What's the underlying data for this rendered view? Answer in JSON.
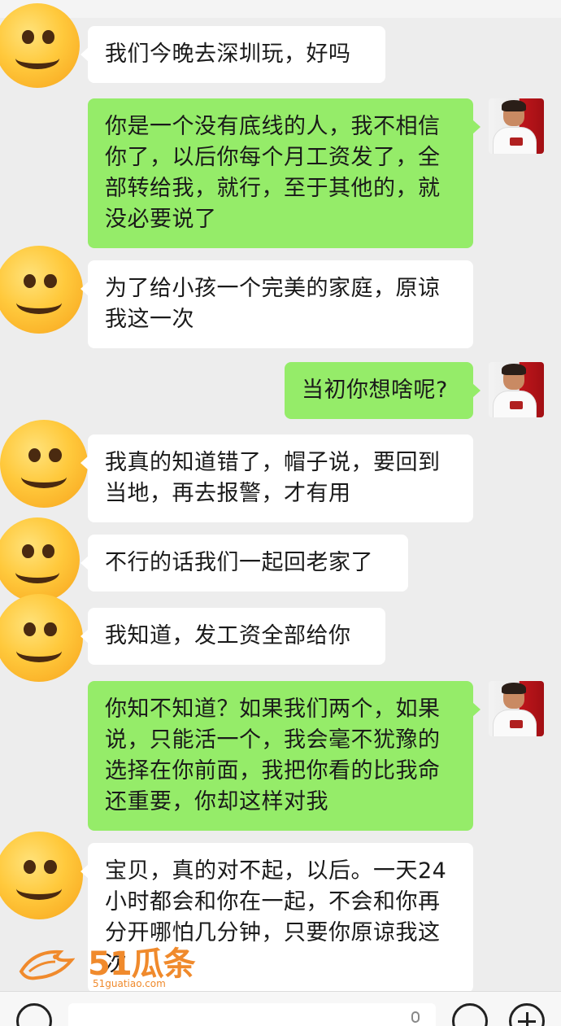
{
  "messages": [
    {
      "side": "left",
      "text": "我们今晚去深圳玩，好吗",
      "avatar": "smiley-emoji-avatar"
    },
    {
      "side": "right",
      "text": "你是一个没有底线的人，我不相信你了，以后你每个月工资发了，全部转给我，就行，至于其他的，就没必要说了",
      "avatar": "user-photo-avatar"
    },
    {
      "side": "left",
      "text": "为了给小孩一个完美的家庭，原谅我这一次",
      "avatar": "smiley-emoji-avatar"
    },
    {
      "side": "right",
      "text": "当初你想啥呢?",
      "avatar": "user-photo-avatar"
    },
    {
      "side": "left",
      "text": "我真的知道错了，帽子说，要回到当地，再去报警，才有用",
      "avatar": "smiley-emoji-avatar"
    },
    {
      "side": "left",
      "text": "不行的话我们一起回老家了",
      "avatar": "smiley-emoji-avatar"
    },
    {
      "side": "left",
      "text": "我知道，发工资全部给你",
      "avatar": "smiley-emoji-avatar"
    },
    {
      "side": "right",
      "text": "你知不知道？如果我们两个，如果说，只能活一个，我会毫不犹豫的选择在你前面，我把你看的比我命还重要，你却这样对我",
      "avatar": "user-photo-avatar"
    },
    {
      "side": "left",
      "text": "宝贝，真的对不起，以后。一天24小时都会和你在一起，不会和你再分开哪怕几分钟，只要你原谅我这次",
      "avatar": "smiley-emoji-avatar"
    }
  ],
  "watermark": {
    "brand": "51瓜条",
    "url": "51guatiao.com"
  },
  "input_bar": {
    "icons": [
      "voice-icon",
      "emoji-icon",
      "plus-icon"
    ]
  },
  "colors": {
    "background": "#ededed",
    "left_bubble": "#ffffff",
    "right_bubble": "#95ec69",
    "watermark": "#f08a2c"
  }
}
